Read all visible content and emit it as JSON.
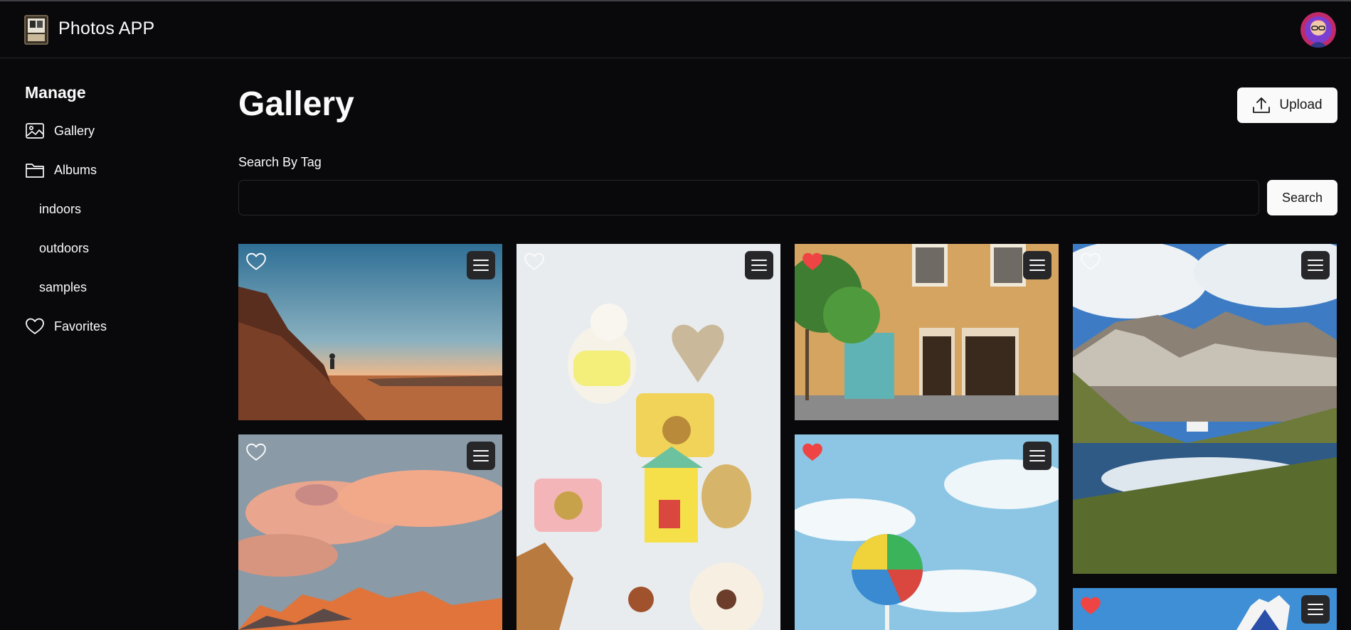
{
  "app": {
    "title": "Photos APP"
  },
  "sidebar": {
    "heading": "Manage",
    "gallery_label": "Gallery",
    "albums_label": "Albums",
    "albums": [
      {
        "label": "indoors"
      },
      {
        "label": "outdoors"
      },
      {
        "label": "samples"
      }
    ],
    "favorites_label": "Favorites"
  },
  "main": {
    "title": "Gallery",
    "upload_label": "Upload",
    "search": {
      "label": "Search By Tag",
      "value": "",
      "placeholder": "",
      "button_label": "Search"
    }
  },
  "colors": {
    "background": "#09090b",
    "border": "#27272a",
    "button_light": "#fafafa",
    "favorite_red": "#ef4444"
  },
  "photos": [
    {
      "name": "desert-cliff-sunset",
      "favorite": false
    },
    {
      "name": "toys-ornaments-flatlay",
      "favorite": false
    },
    {
      "name": "yellow-building-facade",
      "favorite": true
    },
    {
      "name": "mountain-lake-reflection",
      "favorite": false
    },
    {
      "name": "pink-clouds-peaks",
      "favorite": false
    },
    {
      "name": "beach-ball-lollipop",
      "favorite": true
    },
    {
      "name": "blue-white-sculpture",
      "favorite": true
    }
  ]
}
